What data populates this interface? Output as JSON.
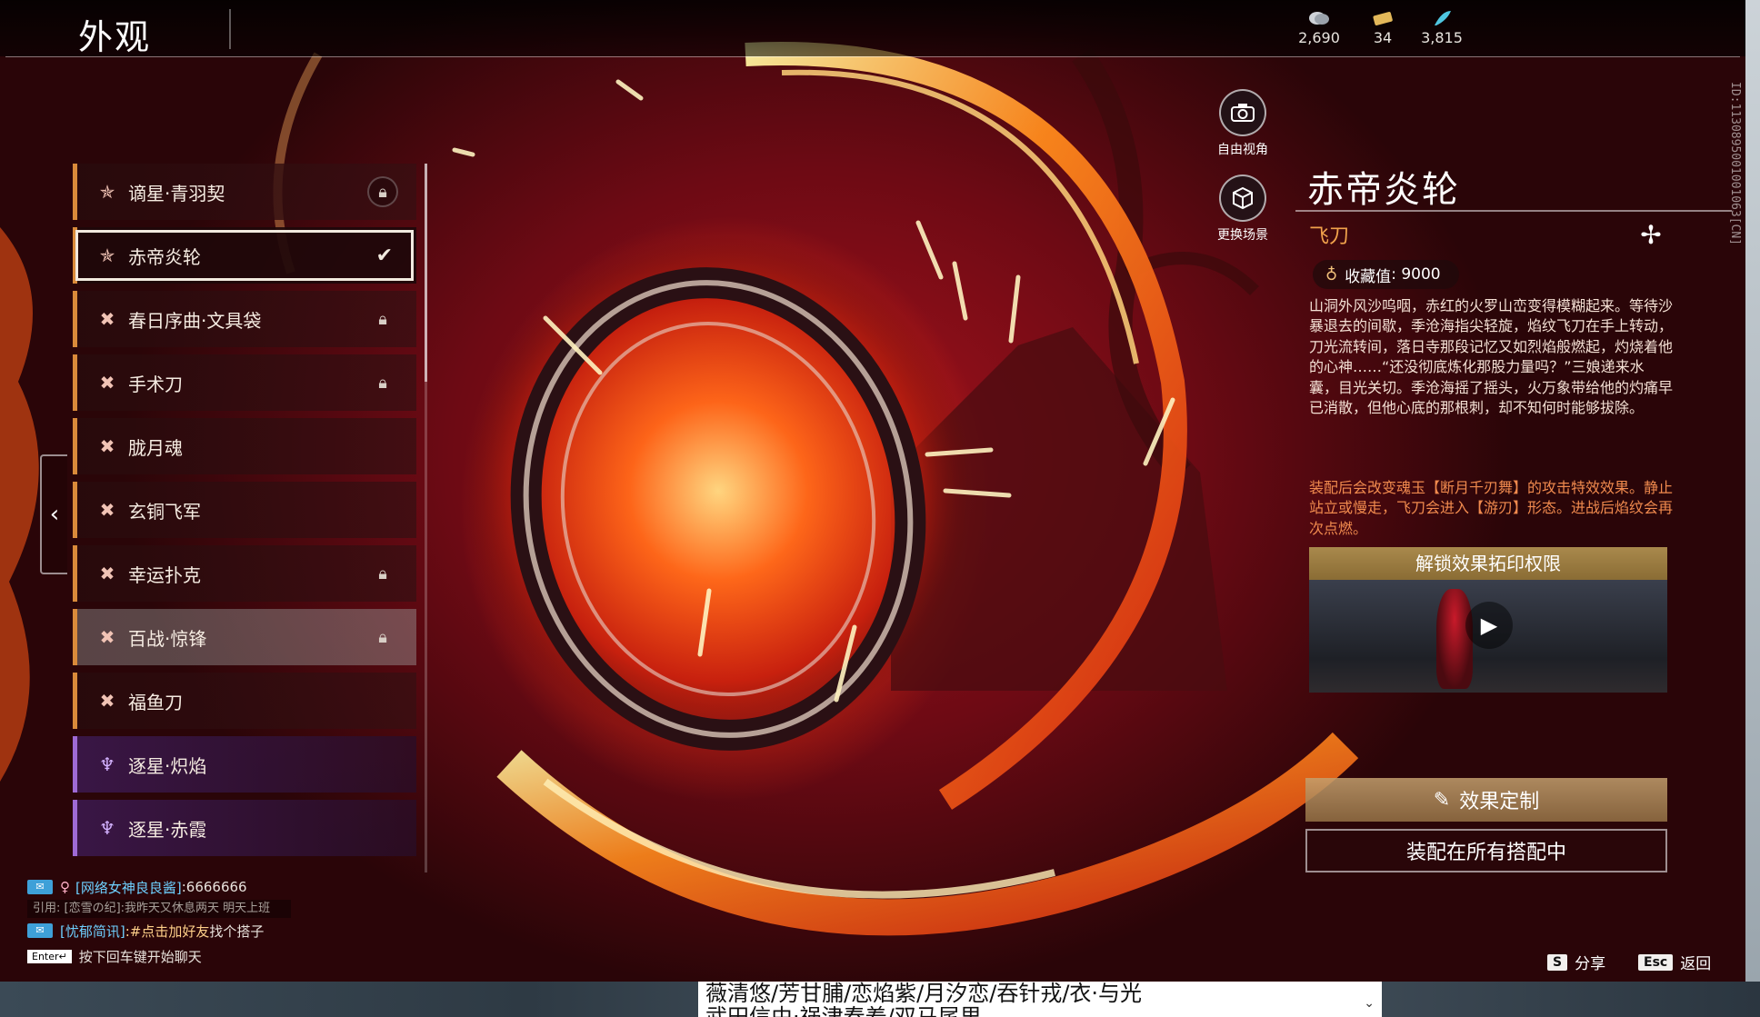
{
  "header": {
    "title": "外观",
    "currencies": [
      {
        "icon": "coin-stack-icon",
        "value": "2,690"
      },
      {
        "icon": "ticket-icon",
        "value": "34"
      },
      {
        "icon": "feather-icon",
        "value": "3,815"
      }
    ]
  },
  "side_id": "ID:1130895001001063[CN]",
  "camera": {
    "free_view": "自由视角",
    "change_scene": "更换场景"
  },
  "list": {
    "items": [
      {
        "name": "谪星·青羽契",
        "locked": true
      },
      {
        "name": "赤帝炎轮",
        "selected": true
      },
      {
        "name": "春日序曲·文具袋",
        "locked": true
      },
      {
        "name": "手术刀",
        "locked": true
      },
      {
        "name": "胧月魂"
      },
      {
        "name": "玄铜飞军"
      },
      {
        "name": "幸运扑克",
        "locked": true
      },
      {
        "name": "百战·惊锋",
        "locked": true
      },
      {
        "name": "福鱼刀"
      },
      {
        "name": "逐星·炽焰"
      },
      {
        "name": "逐星·赤霞"
      }
    ]
  },
  "detail": {
    "title": "赤帝炎轮",
    "subtitle": "飞刀",
    "collect_label": "收藏值",
    "collect_sep": ":",
    "collect_value": "9000",
    "description": "山洞外风沙呜咽，赤红的火罗山峦变得模糊起来。等待沙暴退去的间歇，季沧海指尖轻旋，焰纹飞刀在手上转动，刀光流转间，落日寺那段记忆又如烈焰般燃起，灼烧着他的心神……“还没彻底炼化那股力量吗？”三娘递来水囊，目光关切。季沧海摇了摇头，火万象带给他的灼痛早已消散，但他心底的那根刺，却不知何时能够拔除。",
    "effect": "装配后会改变魂玉【断月千刃舞】的攻击特效效果。静止站立或慢走，飞刀会进入【游刃】形态。进战后焰纹会再次点燃。",
    "unlock_label": "解锁效果拓印权限",
    "btn_effect": "效果定制",
    "btn_equip": "装配在所有搭配中"
  },
  "chat": {
    "line1_name": "[网络女神良良酱]",
    "line1_msg": ":6666666",
    "quote": "引用: [恋雪の纪]:我昨天又休息两天 明天上班",
    "line2_name": "[忧郁简讯]",
    "line2_link": ":#点击加好友",
    "line2_msg": " 找个搭子",
    "enter_key": "Enter↵",
    "enter_hint": "按下回车键开始聊天"
  },
  "hints": {
    "share_key": "S",
    "share_label": "分享",
    "back_key": "Esc",
    "back_label": "返回"
  },
  "popup_text": "薇清悠/芳甘脯/恋焰紫/月汐恋/吞针戎/衣·与光\n武田信由·祸津春羞/双马尾里"
}
